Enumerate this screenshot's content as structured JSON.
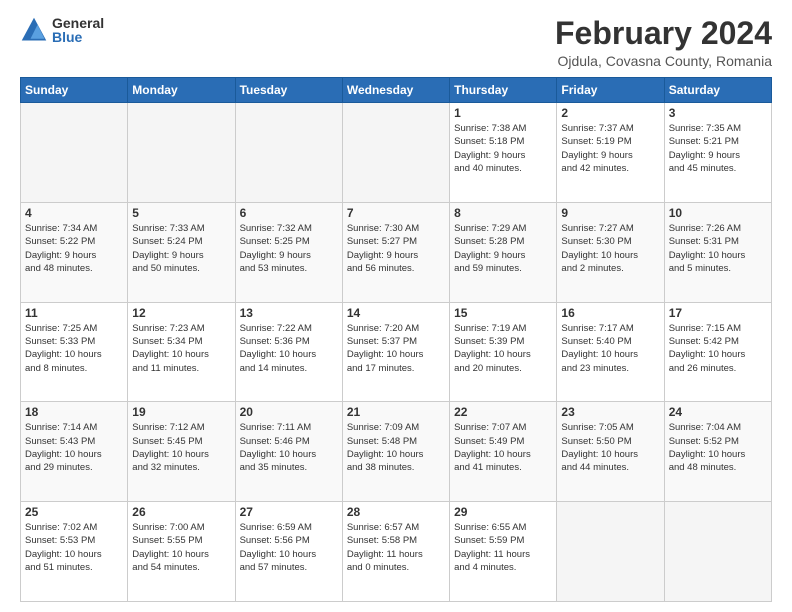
{
  "logo": {
    "general": "General",
    "blue": "Blue"
  },
  "title": "February 2024",
  "subtitle": "Ojdula, Covasna County, Romania",
  "days_header": [
    "Sunday",
    "Monday",
    "Tuesday",
    "Wednesday",
    "Thursday",
    "Friday",
    "Saturday"
  ],
  "weeks": [
    [
      {
        "day": "",
        "info": ""
      },
      {
        "day": "",
        "info": ""
      },
      {
        "day": "",
        "info": ""
      },
      {
        "day": "",
        "info": ""
      },
      {
        "day": "1",
        "info": "Sunrise: 7:38 AM\nSunset: 5:18 PM\nDaylight: 9 hours\nand 40 minutes."
      },
      {
        "day": "2",
        "info": "Sunrise: 7:37 AM\nSunset: 5:19 PM\nDaylight: 9 hours\nand 42 minutes."
      },
      {
        "day": "3",
        "info": "Sunrise: 7:35 AM\nSunset: 5:21 PM\nDaylight: 9 hours\nand 45 minutes."
      }
    ],
    [
      {
        "day": "4",
        "info": "Sunrise: 7:34 AM\nSunset: 5:22 PM\nDaylight: 9 hours\nand 48 minutes."
      },
      {
        "day": "5",
        "info": "Sunrise: 7:33 AM\nSunset: 5:24 PM\nDaylight: 9 hours\nand 50 minutes."
      },
      {
        "day": "6",
        "info": "Sunrise: 7:32 AM\nSunset: 5:25 PM\nDaylight: 9 hours\nand 53 minutes."
      },
      {
        "day": "7",
        "info": "Sunrise: 7:30 AM\nSunset: 5:27 PM\nDaylight: 9 hours\nand 56 minutes."
      },
      {
        "day": "8",
        "info": "Sunrise: 7:29 AM\nSunset: 5:28 PM\nDaylight: 9 hours\nand 59 minutes."
      },
      {
        "day": "9",
        "info": "Sunrise: 7:27 AM\nSunset: 5:30 PM\nDaylight: 10 hours\nand 2 minutes."
      },
      {
        "day": "10",
        "info": "Sunrise: 7:26 AM\nSunset: 5:31 PM\nDaylight: 10 hours\nand 5 minutes."
      }
    ],
    [
      {
        "day": "11",
        "info": "Sunrise: 7:25 AM\nSunset: 5:33 PM\nDaylight: 10 hours\nand 8 minutes."
      },
      {
        "day": "12",
        "info": "Sunrise: 7:23 AM\nSunset: 5:34 PM\nDaylight: 10 hours\nand 11 minutes."
      },
      {
        "day": "13",
        "info": "Sunrise: 7:22 AM\nSunset: 5:36 PM\nDaylight: 10 hours\nand 14 minutes."
      },
      {
        "day": "14",
        "info": "Sunrise: 7:20 AM\nSunset: 5:37 PM\nDaylight: 10 hours\nand 17 minutes."
      },
      {
        "day": "15",
        "info": "Sunrise: 7:19 AM\nSunset: 5:39 PM\nDaylight: 10 hours\nand 20 minutes."
      },
      {
        "day": "16",
        "info": "Sunrise: 7:17 AM\nSunset: 5:40 PM\nDaylight: 10 hours\nand 23 minutes."
      },
      {
        "day": "17",
        "info": "Sunrise: 7:15 AM\nSunset: 5:42 PM\nDaylight: 10 hours\nand 26 minutes."
      }
    ],
    [
      {
        "day": "18",
        "info": "Sunrise: 7:14 AM\nSunset: 5:43 PM\nDaylight: 10 hours\nand 29 minutes."
      },
      {
        "day": "19",
        "info": "Sunrise: 7:12 AM\nSunset: 5:45 PM\nDaylight: 10 hours\nand 32 minutes."
      },
      {
        "day": "20",
        "info": "Sunrise: 7:11 AM\nSunset: 5:46 PM\nDaylight: 10 hours\nand 35 minutes."
      },
      {
        "day": "21",
        "info": "Sunrise: 7:09 AM\nSunset: 5:48 PM\nDaylight: 10 hours\nand 38 minutes."
      },
      {
        "day": "22",
        "info": "Sunrise: 7:07 AM\nSunset: 5:49 PM\nDaylight: 10 hours\nand 41 minutes."
      },
      {
        "day": "23",
        "info": "Sunrise: 7:05 AM\nSunset: 5:50 PM\nDaylight: 10 hours\nand 44 minutes."
      },
      {
        "day": "24",
        "info": "Sunrise: 7:04 AM\nSunset: 5:52 PM\nDaylight: 10 hours\nand 48 minutes."
      }
    ],
    [
      {
        "day": "25",
        "info": "Sunrise: 7:02 AM\nSunset: 5:53 PM\nDaylight: 10 hours\nand 51 minutes."
      },
      {
        "day": "26",
        "info": "Sunrise: 7:00 AM\nSunset: 5:55 PM\nDaylight: 10 hours\nand 54 minutes."
      },
      {
        "day": "27",
        "info": "Sunrise: 6:59 AM\nSunset: 5:56 PM\nDaylight: 10 hours\nand 57 minutes."
      },
      {
        "day": "28",
        "info": "Sunrise: 6:57 AM\nSunset: 5:58 PM\nDaylight: 11 hours\nand 0 minutes."
      },
      {
        "day": "29",
        "info": "Sunrise: 6:55 AM\nSunset: 5:59 PM\nDaylight: 11 hours\nand 4 minutes."
      },
      {
        "day": "",
        "info": ""
      },
      {
        "day": "",
        "info": ""
      }
    ]
  ]
}
